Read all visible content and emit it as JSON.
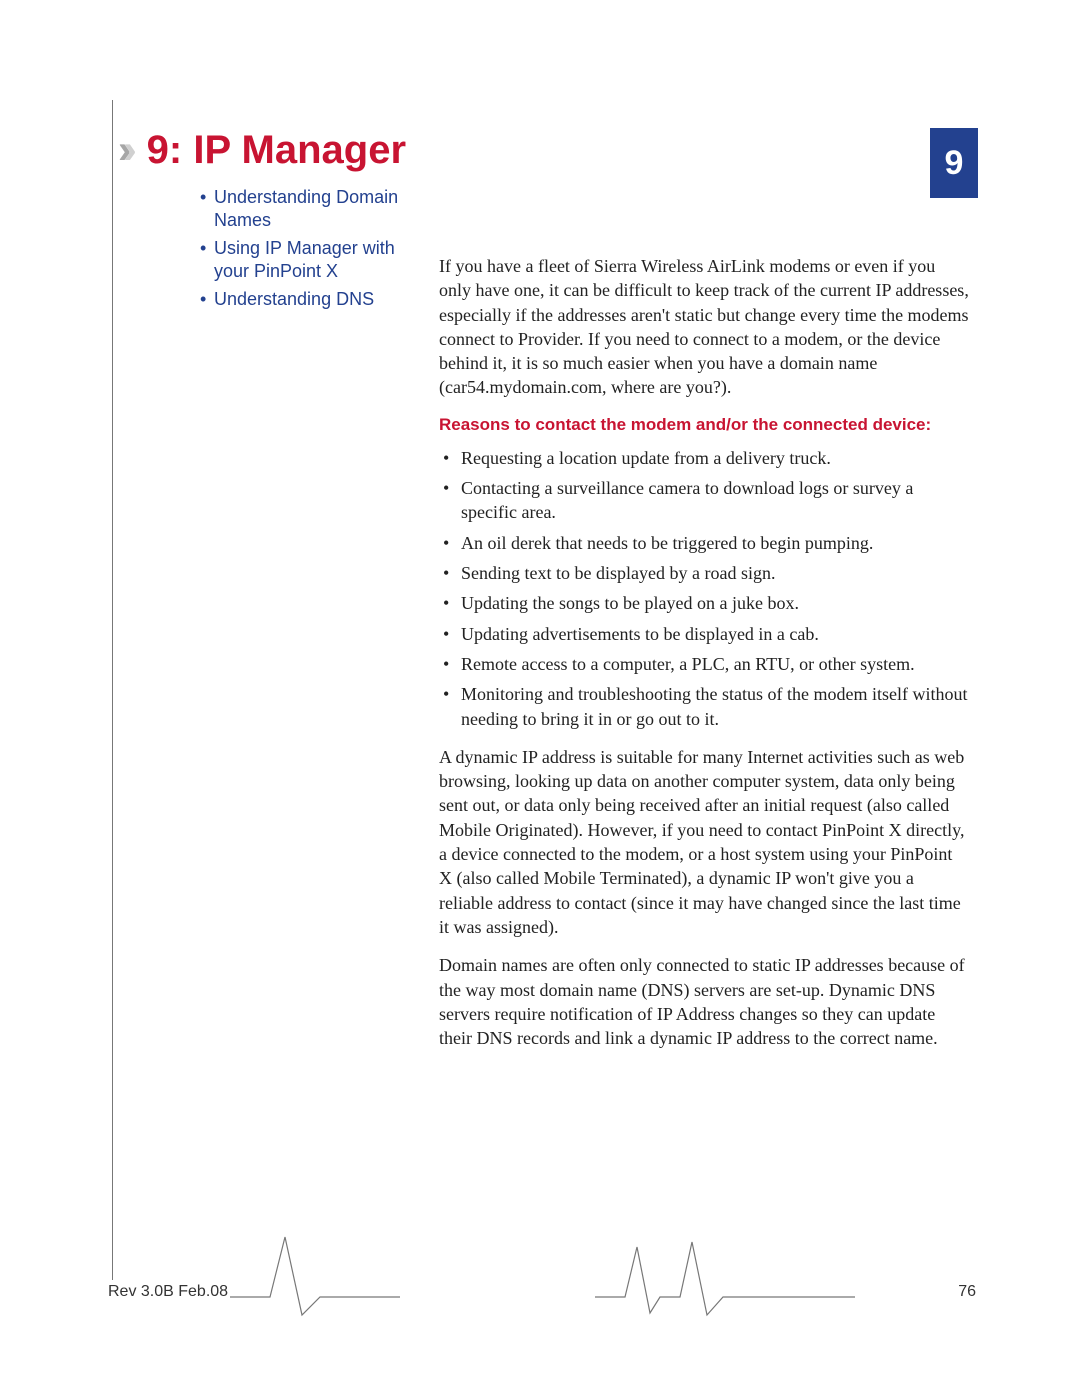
{
  "chapter_number": "9",
  "title": "9: IP Manager",
  "toc": [
    "Understanding Domain Names",
    "Using IP Manager with your PinPoint X",
    "Understanding DNS"
  ],
  "intro": "If you have a fleet of Sierra Wireless AirLink modems or even if you only have one, it can be difficult to keep track of the current IP addresses, especially if the addresses aren't static but change every time the modems connect to Provider. If you need to connect to a modem, or the device behind it, it is so much easier when you have a domain name (car54.mydomain.com, where are you?).",
  "subhead": "Reasons to contact the modem and/or the connected device:",
  "reasons": [
    "Requesting a location update from a delivery truck.",
    "Contacting a surveillance camera to download logs or survey a specific area.",
    "An oil derek that needs to be triggered to begin pumping.",
    "Sending text to be displayed by a road sign.",
    "Updating the songs to be played on a juke box.",
    "Updating advertisements to be displayed in a cab.",
    "Remote access to a computer, a PLC, an RTU, or other system.",
    "Monitoring and troubleshooting the status of the modem itself without needing to bring it in or go out to it."
  ],
  "para2": "A dynamic IP address is suitable for many Internet activities such as web browsing, looking up data on another computer system, data only being sent out, or data only being received after an initial request (also called Mobile Originated). However, if you need to contact PinPoint X directly, a device connected to the modem, or a host system using your PinPoint X (also called Mobile Terminated), a dynamic IP won't give you a reliable address to contact (since it may have changed since the last time it was assigned).",
  "para3": "Domain names are often only connected to static IP addresses because of the way most domain name (DNS) servers are set-up. Dynamic DNS servers require notification of IP Address changes so they can update their DNS records and link a dynamic IP address to the correct name.",
  "footer_rev": "Rev 3.0B  Feb.08",
  "footer_page": "76"
}
